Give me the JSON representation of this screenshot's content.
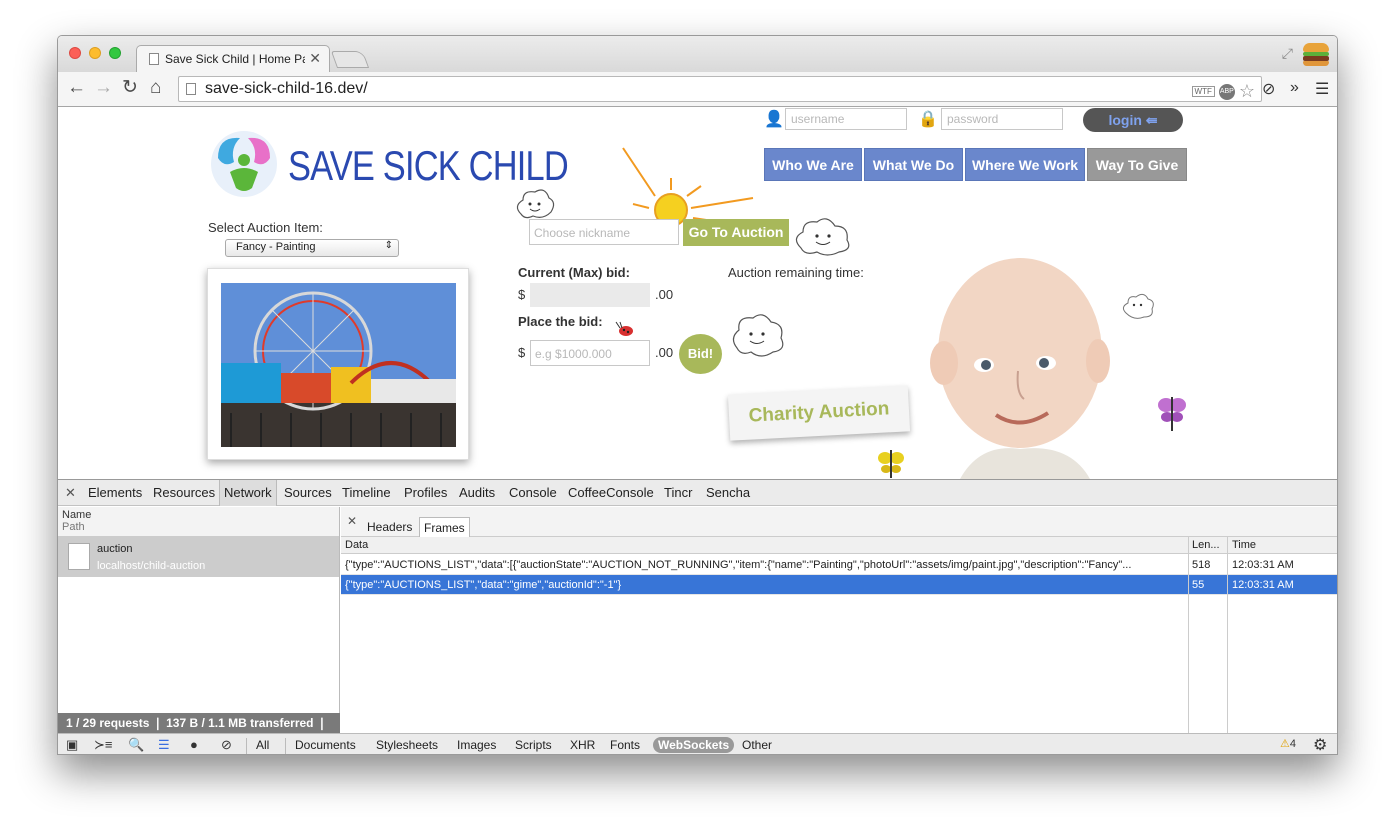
{
  "browser": {
    "tab_title": "Save Sick Child | Home Pag",
    "url": "save-sick-child-16.dev/",
    "omnibox_badges": [
      "WTF",
      "ABP"
    ]
  },
  "site": {
    "brand": "SAVE SICK CHILD",
    "username_placeholder": "username",
    "password_placeholder": "password",
    "login_label": "login",
    "nav": [
      "Who We Are",
      "What We Do",
      "Where We Work",
      "Way To Give"
    ],
    "select_auction_label": "Select Auction Item:",
    "selected_item": "Fancy - Painting",
    "nickname_placeholder": "Choose nickname",
    "go_to_auction": "Go To Auction",
    "current_bid_label": "Current (Max) bid:",
    "remaining_time_label": "Auction remaining time:",
    "currency": "$",
    "cents": ".00",
    "place_bid_label": "Place the bid:",
    "bid_placeholder": "e.g $1000.000",
    "bid_button": "Bid!",
    "charity_label": "Charity Auction"
  },
  "devtools": {
    "tabs": [
      "Elements",
      "Resources",
      "Network",
      "Sources",
      "Timeline",
      "Profiles",
      "Audits",
      "Console",
      "CoffeeConsole",
      "Tincr",
      "Sencha"
    ],
    "active_tab": "Network",
    "left_header": {
      "name": "Name",
      "path": "Path"
    },
    "request": {
      "name": "auction",
      "path": "localhost/child-auction"
    },
    "status": "1 / 29 requests  ❘  137 B / 1.1 MB transferred  ❘",
    "subtabs": [
      "Headers",
      "Frames"
    ],
    "columns": [
      "Data",
      "Len...",
      "Time"
    ],
    "frames": [
      {
        "data": "{\"type\":\"AUCTIONS_LIST\",\"data\":[{\"auctionState\":\"AUCTION_NOT_RUNNING\",\"item\":{\"name\":\"Painting\",\"photoUrl\":\"assets/img/paint.jpg\",\"description\":\"Fancy\"...",
        "length": "518",
        "time": "12:03:31 AM"
      },
      {
        "data": "{\"type\":\"AUCTIONS_LIST\",\"data\":\"gime\",\"auctionId\":\"-1\"}",
        "length": "55",
        "time": "12:03:31 AM"
      }
    ],
    "filters": [
      "All",
      "Documents",
      "Stylesheets",
      "Images",
      "Scripts",
      "XHR",
      "Fonts",
      "WebSockets",
      "Other"
    ],
    "active_filter": "WebSockets",
    "warning_count": "4"
  }
}
